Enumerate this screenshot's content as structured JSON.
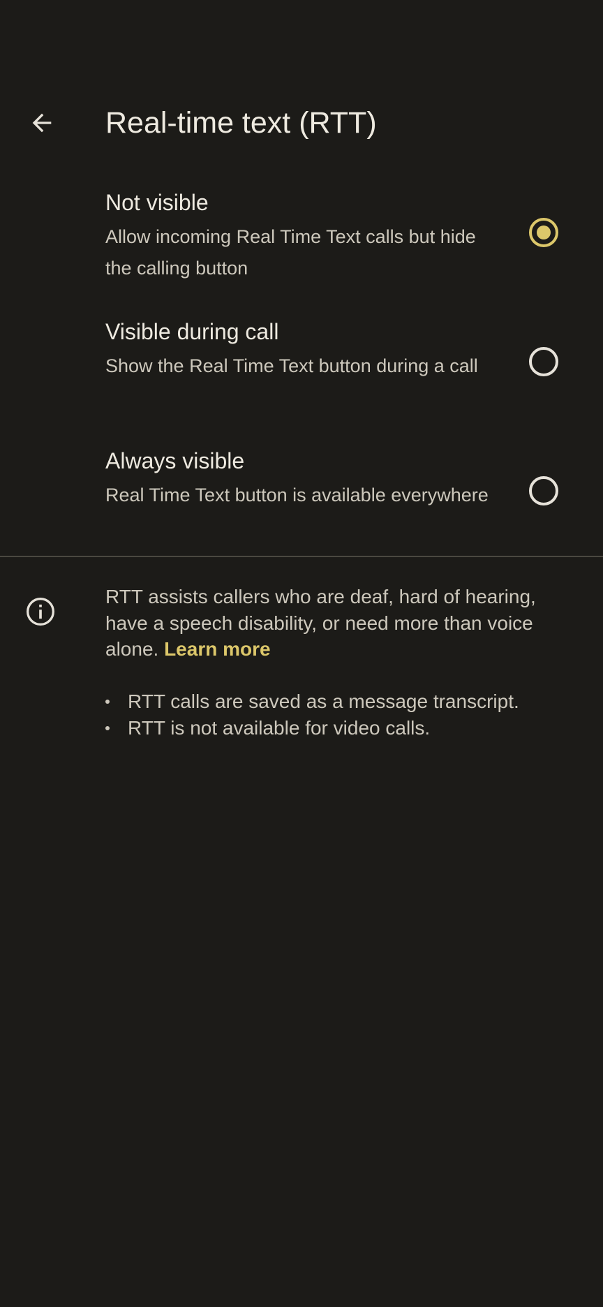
{
  "app_bar": {
    "back_icon": "arrow-back-icon",
    "title": "Real-time text (RTT)"
  },
  "options": [
    {
      "title": "Not visible",
      "summary": "Allow incoming Real Time Text calls but hide the calling button",
      "selected": true
    },
    {
      "title": "Visible during call",
      "summary": "Show the Real Time Text button during a call",
      "selected": false
    },
    {
      "title": "Always visible",
      "summary": "Real Time Text button is available everywhere",
      "selected": false
    }
  ],
  "info": {
    "icon": "info-icon",
    "text": "RTT assists callers who are deaf, hard of hearing, have a speech disability, or need more than voice alone.",
    "learn_more": "Learn more",
    "bullets": [
      "RTT calls are saved as a message transcript.",
      "RTT is not available for video calls."
    ]
  },
  "colors": {
    "background": "#1c1b18",
    "accent": "#dcc76a",
    "text_primary": "#eeeae0",
    "text_secondary": "#cdc8bc"
  }
}
